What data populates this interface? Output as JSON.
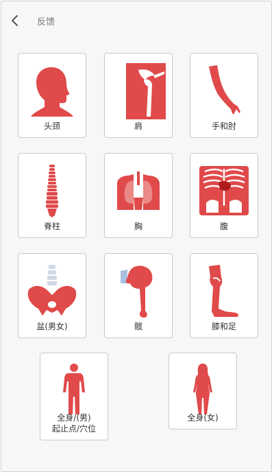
{
  "header": {
    "back_icon": "chevron-left-icon",
    "title": "反馈"
  },
  "colors": {
    "accent": "#e04a4a",
    "border": "#c9c9c9",
    "background": "#f7f7f7"
  },
  "parts": [
    {
      "label": "头颈",
      "icon": "head-neck-icon"
    },
    {
      "label": "肩",
      "icon": "shoulder-icon"
    },
    {
      "label": "手和肘",
      "icon": "arm-icon"
    },
    {
      "label": "脊柱",
      "icon": "spine-icon"
    },
    {
      "label": "胸",
      "icon": "chest-icon"
    },
    {
      "label": "腹",
      "icon": "abdomen-icon"
    },
    {
      "label": "盆(男女)",
      "icon": "pelvis-icon"
    },
    {
      "label": "髋",
      "icon": "hip-icon"
    },
    {
      "label": "膝和足",
      "icon": "knee-foot-icon"
    },
    {
      "label": "全身/(男)\n起止点/穴位",
      "icon": "male-body-icon"
    },
    {
      "label": "全身(女)",
      "icon": "female-body-icon"
    }
  ]
}
